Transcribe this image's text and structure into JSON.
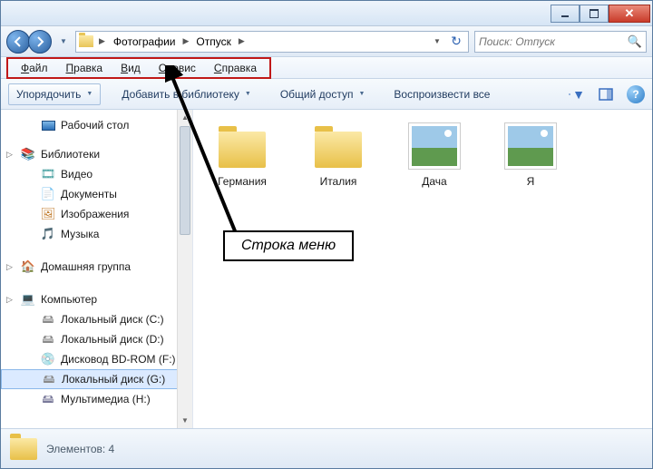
{
  "path": {
    "segments": [
      "Фотографии",
      "Отпуск"
    ],
    "folder_icon": "folder-icon"
  },
  "search": {
    "placeholder": "Поиск: Отпуск"
  },
  "menubar": {
    "items": [
      "Файл",
      "Правка",
      "Вид",
      "Сервис",
      "Справка"
    ]
  },
  "toolbar": {
    "organize": "Упорядочить",
    "add_library": "Добавить в библиотеку",
    "share": "Общий доступ",
    "play_all": "Воспроизвести все",
    "icons": {
      "view": "view-options-icon",
      "preview": "preview-pane-icon",
      "help": "help-icon"
    }
  },
  "sidebar": {
    "desktop": "Рабочий стол",
    "libraries": "Библиотеки",
    "videos": "Видео",
    "documents": "Документы",
    "pictures": "Изображения",
    "music": "Музыка",
    "homegroup": "Домашняя группа",
    "computer": "Компьютер",
    "disks": [
      {
        "label": "Локальный диск (C:)",
        "icon": "disk-icon"
      },
      {
        "label": "Локальный диск (D:)",
        "icon": "disk-icon"
      },
      {
        "label": "Дисковод BD-ROM (F:)",
        "icon": "bd-icon"
      },
      {
        "label": "Локальный диск (G:)",
        "icon": "disk-icon",
        "selected": true
      },
      {
        "label": "Мультимедиа (H:)",
        "icon": "media-icon"
      }
    ]
  },
  "content": {
    "items": [
      {
        "name": "Германия",
        "type": "folder"
      },
      {
        "name": "Италия",
        "type": "folder"
      },
      {
        "name": "Дача",
        "type": "image"
      },
      {
        "name": "Я",
        "type": "image"
      }
    ]
  },
  "statusbar": {
    "label": "Элементов: 4"
  },
  "annotation": {
    "label": "Строка меню"
  }
}
